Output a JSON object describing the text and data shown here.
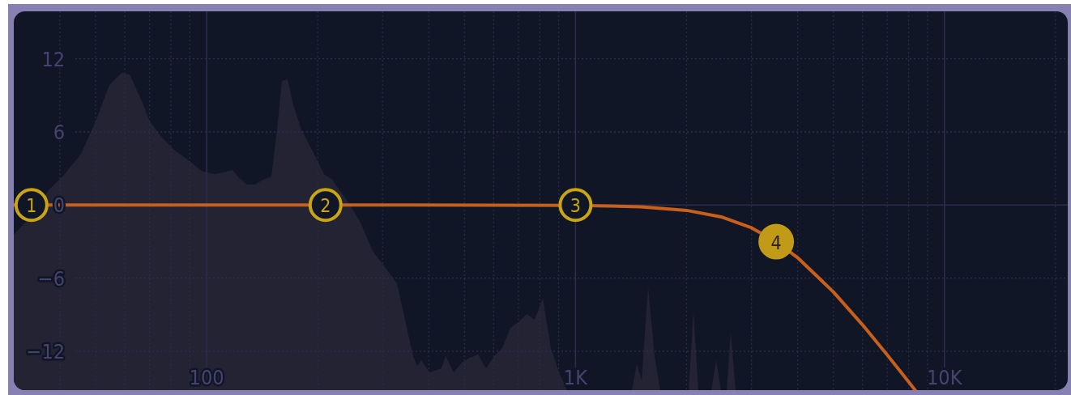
{
  "y_axis_labels": [
    "12",
    "6",
    "0",
    "−6",
    "−12"
  ],
  "x_axis_labels": [
    "100",
    "1K",
    "10K"
  ],
  "bands": [
    {
      "label": "1",
      "selected": false
    },
    {
      "label": "2",
      "selected": false
    },
    {
      "label": "3",
      "selected": false
    },
    {
      "label": "4",
      "selected": true
    }
  ]
}
